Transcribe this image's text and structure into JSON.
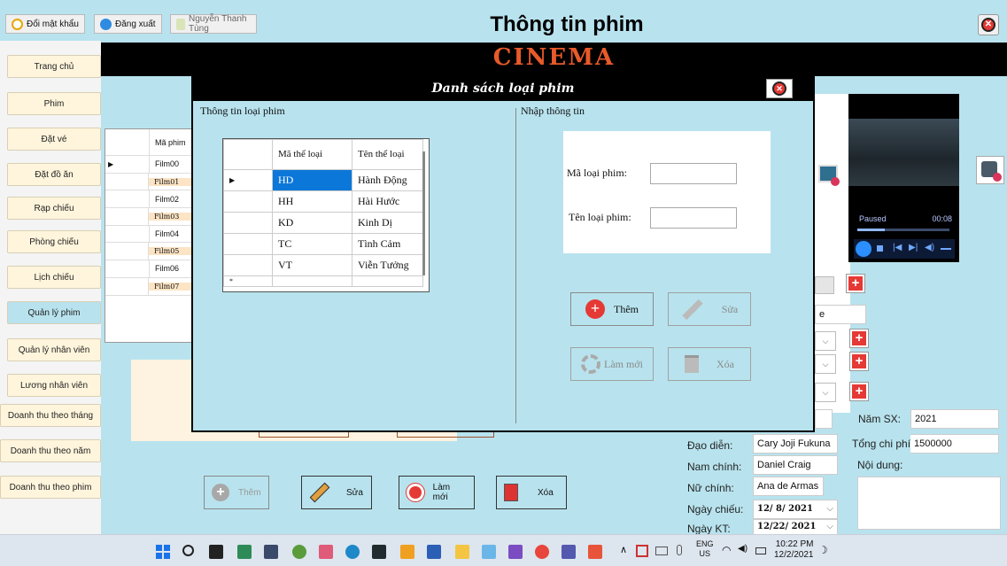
{
  "window": {
    "title": "Thông tin phim",
    "change_password": "Đổi mật khẩu",
    "logout": "Đăng xuất",
    "user": "Nguyễn Thanh Tùng",
    "brand": "CINEMA"
  },
  "sidebar": {
    "items": [
      {
        "label": "Trang chủ"
      },
      {
        "label": "Phim"
      },
      {
        "label": "Đặt vé"
      },
      {
        "label": "Đặt đồ ăn"
      },
      {
        "label": "Rạp chiếu"
      },
      {
        "label": "Phòng chiếu"
      },
      {
        "label": "Lịch chiếu"
      },
      {
        "label": "Quản lý phim"
      },
      {
        "label": "Quản lý nhân viên"
      },
      {
        "label": "Lương nhân viên"
      },
      {
        "label": "Doanh thu theo tháng"
      },
      {
        "label": "Doanh thu theo năm"
      },
      {
        "label": "Doanh thu theo phim"
      }
    ]
  },
  "film_table": {
    "header": "Mã phim",
    "rows": [
      "Film00",
      "Film01",
      "Film02",
      "Film03",
      "Film04",
      "Film05",
      "Film06",
      "Film07"
    ]
  },
  "modal": {
    "title": "Danh sách loại phim",
    "left_section": "Thông tin loại phim",
    "right_section": "Nhập thông tin",
    "columns": [
      "Mã thể loại",
      "Tên thể loại"
    ],
    "rows": [
      {
        "code": "HD",
        "name": "Hành Động"
      },
      {
        "code": "HH",
        "name": "Hài Hước"
      },
      {
        "code": "KD",
        "name": "Kinh Dị"
      },
      {
        "code": "TC",
        "name": "Tình Cảm"
      },
      {
        "code": "VT",
        "name": "Viễn Tưởng"
      }
    ],
    "code_label": "Mã loại phim:",
    "name_label": "Tên loại phim:",
    "btn_add": "Thêm",
    "btn_edit": "Sửa",
    "btn_refresh": "Làm mới",
    "btn_delete": "Xóa"
  },
  "video": {
    "status": "Paused",
    "time": "00:08"
  },
  "details": {
    "partial_field": "e",
    "year_label": "Năm SX:",
    "year": "2021",
    "director_label": "Đạo diễn:",
    "director": "Cary Joji Fukuna",
    "cost_label": "Tổng chi phí",
    "cost": "1500000",
    "male_label": "Nam chính:",
    "male": "Daniel Craig",
    "content_label": "Nội dung:",
    "female_label": "Nữ chính:",
    "female": "Ana de Armas",
    "show_date_label": "Ngày chiếu:",
    "show_date": "12/ 8/ 2021",
    "end_date_label": "Ngày KT:",
    "end_date": "12/22/ 2021"
  },
  "bottom_buttons": {
    "add": "Thêm",
    "edit": "Sửa",
    "refresh": "Làm mới",
    "delete": "Xóa"
  },
  "taskbar": {
    "lang": "ENG",
    "region": "US",
    "time": "10:22 PM",
    "date": "12/2/2021"
  },
  "colors": {
    "background": "#b8e3ee",
    "accent_red": "#e53935",
    "nav_bg": "#fff5dc",
    "selected_blue": "#0b77d9"
  }
}
